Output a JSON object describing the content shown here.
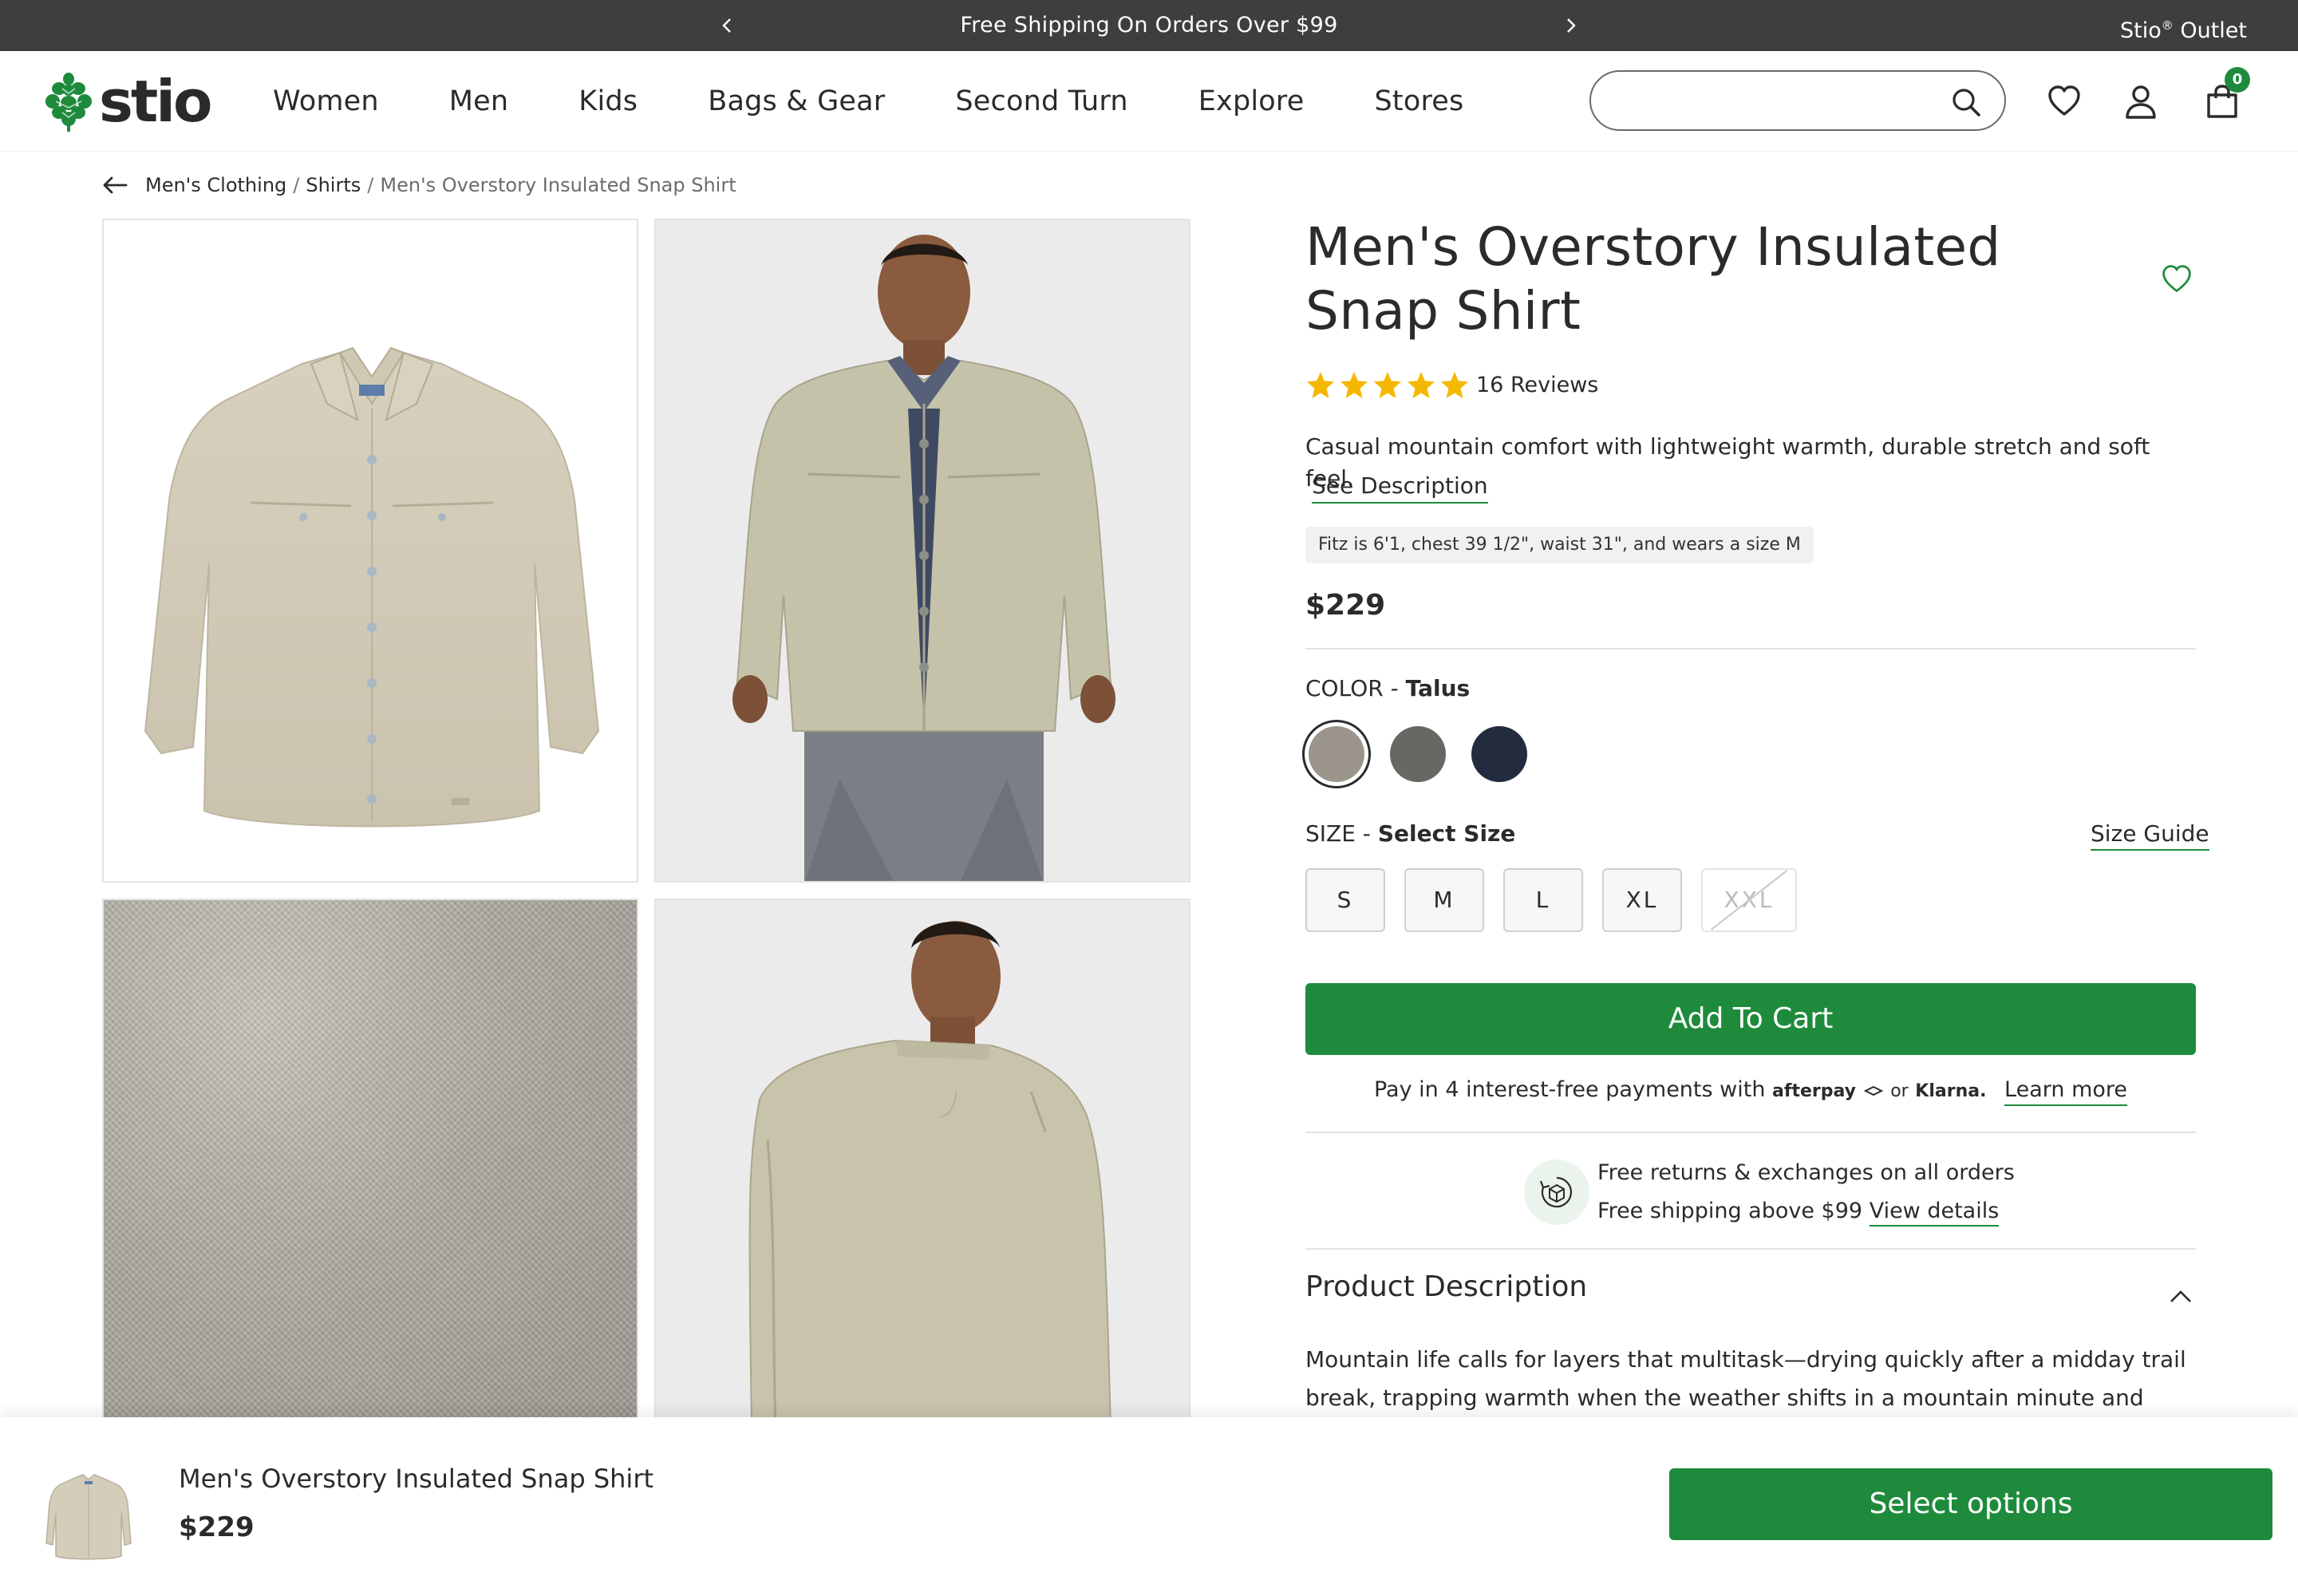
{
  "announcement": {
    "message": "Free Shipping On Orders Over $99",
    "outlet_label": "Stio",
    "outlet_mark": "®",
    "outlet_suffix": " Outlet"
  },
  "header": {
    "logo_text": "stio",
    "nav": [
      "Women",
      "Men",
      "Kids",
      "Bags & Gear",
      "Second Turn",
      "Explore",
      "Stores"
    ],
    "search_placeholder": "",
    "cart_count": "0"
  },
  "breadcrumb": {
    "items": [
      "Men's Clothing",
      "Shirts"
    ],
    "separator": "/",
    "current": "Men's Overstory Insulated Snap Shirt"
  },
  "product": {
    "title": "Men's Overstory Insulated Snap Shirt",
    "rating": 5,
    "reviews_label": "16 Reviews",
    "tagline": "Casual mountain comfort with lightweight warmth, durable stretch and soft feel.",
    "see_description": "See Description",
    "fit_note": "Fitz is 6'1, chest 39 1/2\", waist 31\", and wears a size M",
    "price": "$229",
    "color_label": "COLOR - ",
    "color_value": "Talus",
    "colors": [
      {
        "name": "Talus",
        "hex": "#9c958b",
        "selected": true
      },
      {
        "name": "Grey",
        "hex": "#666963",
        "selected": false
      },
      {
        "name": "Navy",
        "hex": "#232b3f",
        "selected": false
      }
    ],
    "size_label": "SIZE - ",
    "size_value": "Select Size",
    "size_guide": "Size Guide",
    "sizes": [
      {
        "label": "S",
        "available": true
      },
      {
        "label": "M",
        "available": true
      },
      {
        "label": "L",
        "available": true
      },
      {
        "label": "XL",
        "available": true
      },
      {
        "label": "XXL",
        "available": false
      }
    ],
    "add_to_cart": "Add To Cart",
    "pay": {
      "prefix": "Pay in 4 interest-free payments with",
      "afterpay": "afterpay",
      "or": "or",
      "klarna": "Klarna.",
      "learn_more": "Learn more"
    },
    "returns_line": "Free returns & exchanges on all orders",
    "shipping_line": "Free shipping above $99",
    "view_details": "View details",
    "description_heading": "Product Description",
    "description_text": "Mountain life calls for layers that multitask—drying quickly after a midday trail break, trapping warmth when the weather shifts in a mountain minute and looking just as good"
  },
  "sticky_bar": {
    "name": "Men's Overstory Insulated Snap Shirt",
    "price": "$229",
    "button": "Select options"
  },
  "colors": {
    "brand_green": "#1e8b3c",
    "announcement_bg": "#3d3e40",
    "star": "#f5b800"
  }
}
